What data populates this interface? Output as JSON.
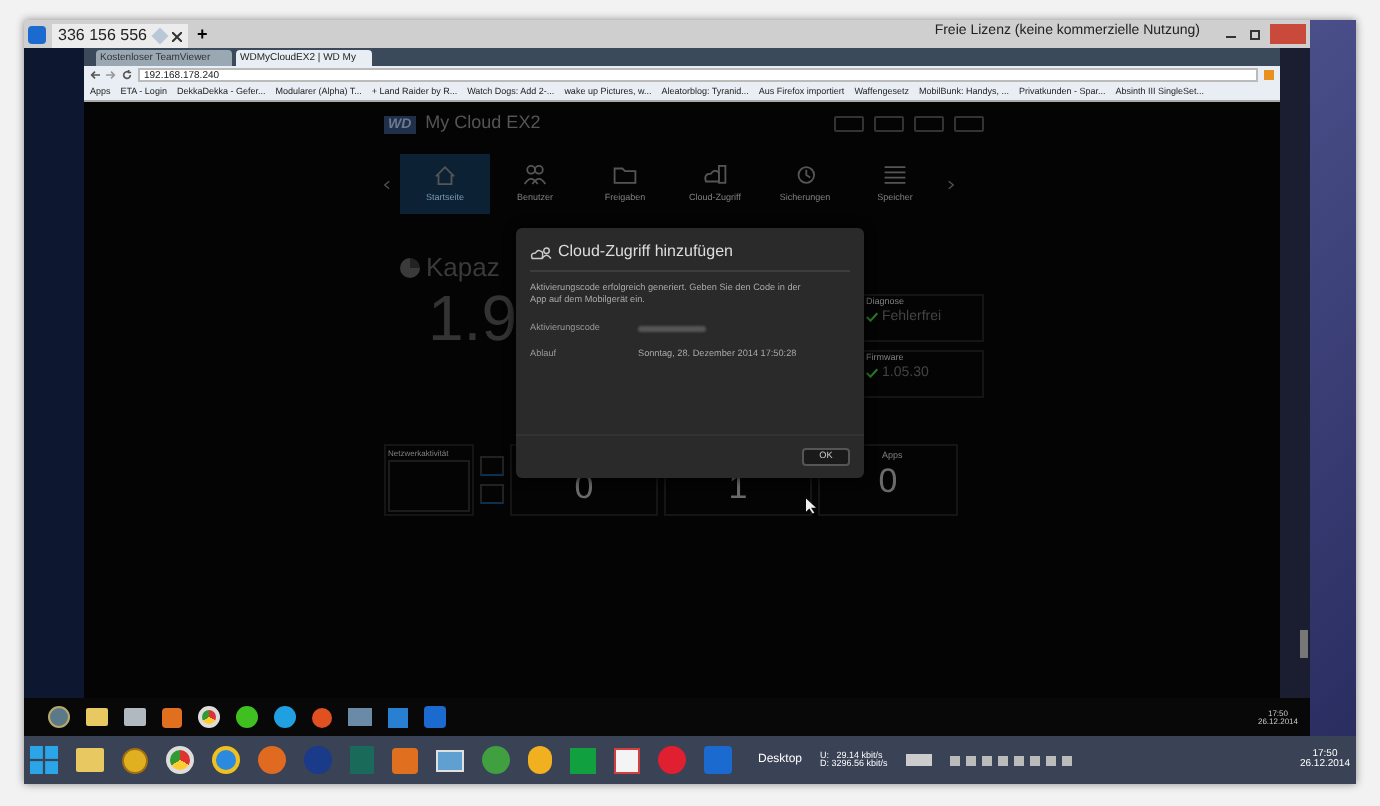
{
  "teamviewer": {
    "tab_title": "336 156 556",
    "add_tab": "+",
    "license": "Freie Lizenz (keine kommerzielle Nutzung)"
  },
  "browser": {
    "tabs": [
      {
        "label": "Kostenloser TeamViewer",
        "selected": false
      },
      {
        "label": "WDMyCloudEX2 | WD My",
        "selected": true
      }
    ],
    "url": "192.168.178.240",
    "bookmarks": [
      "Apps",
      "ETA - Login",
      "DekkaDekka - Gefer...",
      "Modularer (Alpha) T...",
      "+ Land Raider by R...",
      "Watch Dogs: Add 2-...",
      "wake up Pictures, w...",
      "Aleatorblog: Tyranid...",
      "Aus Firefox importiert",
      "Waffengesetz",
      "MobilBunk: Handys, ...",
      "Privatkunden - Spar...",
      "Absinth III SingleSet..."
    ]
  },
  "wd_page": {
    "logo": "WD",
    "title": "My Cloud EX2",
    "nav": [
      {
        "label": "Startseite",
        "selected": true
      },
      {
        "label": "Benutzer",
        "selected": false
      },
      {
        "label": "Freigaben",
        "selected": false
      },
      {
        "label": "Cloud-Zugriff",
        "selected": false
      },
      {
        "label": "Sicherungen",
        "selected": false
      },
      {
        "label": "Speicher",
        "selected": false
      }
    ],
    "capacity_label": "Kapaz",
    "capacity_value": "1.9",
    "status_cards": [
      {
        "label": "Diagnose",
        "value": "Fehlerfrei"
      },
      {
        "label": "Firmware",
        "value": "1.05.30"
      }
    ],
    "network_label": "Netzwerkaktivität",
    "counters": [
      "0",
      "1"
    ],
    "apps": {
      "label": "Apps",
      "value": "0"
    }
  },
  "dialog": {
    "title": "Cloud-Zugriff hinzufügen",
    "message": "Aktivierungscode erfolgreich generiert. Geben Sie den Code in der App auf dem Mobilgerät ein.",
    "fields": [
      {
        "label": "Aktivierungscode",
        "kind": "hidden"
      },
      {
        "label": "Ablauf",
        "kind": "text",
        "value": "Sonntag, 28. Dezember 2014 17:50:28"
      }
    ],
    "button": "OK"
  },
  "remote_taskbar": {
    "time": "17:50",
    "date": "26.12.2014"
  },
  "taskbar": {
    "desktop_label": "Desktop",
    "upload": "U:   29.14 kbit/s",
    "download": "D: 3296.56 kbit/s",
    "time": "17:50",
    "date": "26.12.2014"
  }
}
